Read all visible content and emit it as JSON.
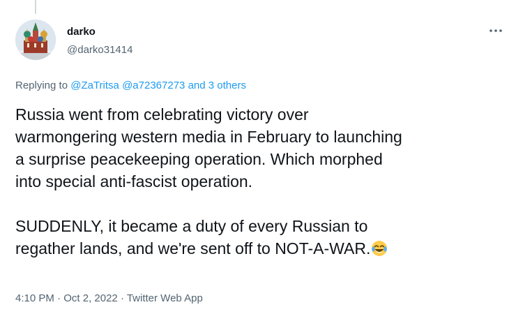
{
  "author": {
    "display_name": "darko",
    "handle": "@darko31414",
    "avatar_icon": "kremlin-cathedral-avatar"
  },
  "menu": {
    "more_icon": "more-horizontal-icon"
  },
  "reply": {
    "prefix": "Replying to ",
    "mention_1": "@ZaTritsa",
    "mention_2": "@a72367273",
    "others": "and 3 others"
  },
  "tweet": {
    "lines_para1": [
      "Russia went from celebrating victory over",
      "warmongering western media in February to launching",
      "a surprise peacekeeping operation. Which morphed",
      "into special anti-fascist operation."
    ],
    "lines_para2": [
      "SUDDENLY, it became a duty of every Russian to",
      "regather lands, and we're sent off to NOT-A-WAR."
    ],
    "emoji": "face-with-tears-of-joy"
  },
  "meta": {
    "time": "4:10 PM",
    "sep": " · ",
    "date": "Oct 2, 2022",
    "source": "Twitter Web App"
  },
  "colors": {
    "link": "#1d9bf0",
    "secondary": "#536471",
    "text": "#0f1419"
  }
}
